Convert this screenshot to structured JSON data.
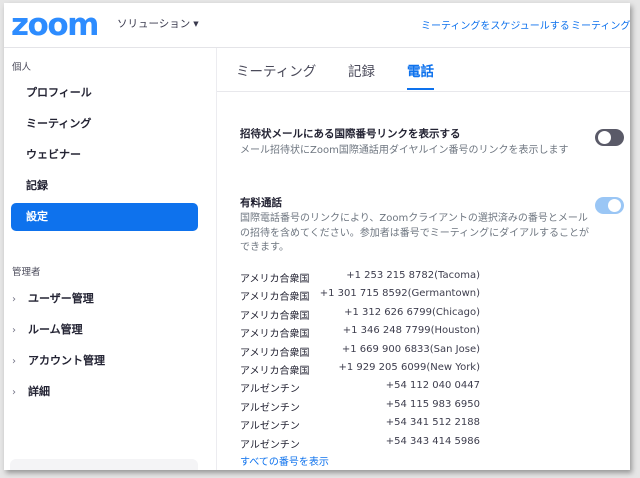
{
  "header": {
    "logo": "zoom",
    "solutions_label": "ソリューション",
    "links": [
      "ミーティングをスケジュールする",
      "ミーティングに参加する"
    ]
  },
  "sidebar": {
    "personal_label": "個人",
    "items": [
      "プロフィール",
      "ミーティング",
      "ウェビナー",
      "記録",
      "設定"
    ],
    "active_index": 4,
    "admin_label": "管理者",
    "admin_items": [
      "ユーザー管理",
      "ルーム管理",
      "アカウント管理",
      "詳細"
    ]
  },
  "tabs": {
    "items": [
      "ミーティング",
      "記録",
      "電話"
    ],
    "active_index": 2
  },
  "settings": [
    {
      "title": "招待状メールにある国際番号リンクを表示する",
      "description": "メール招待状にZoom国際通話用ダイヤルイン番号のリンクを表示します",
      "enabled": false
    },
    {
      "title": "有料通話",
      "description": "国際電話番号のリンクにより、Zoomクライアントの選択済みの番号とメールの招待を含めてください。参加者は番号でミーティングにダイアルすることができます。",
      "enabled": true
    }
  ],
  "numbers": [
    {
      "country": "アメリカ合衆国",
      "number": "+1 253 215 8782(Tacoma)"
    },
    {
      "country": "アメリカ合衆国",
      "number": "+1 301 715 8592(Germantown)"
    },
    {
      "country": "アメリカ合衆国",
      "number": "+1 312 626 6799(Chicago)"
    },
    {
      "country": "アメリカ合衆国",
      "number": "+1 346 248 7799(Houston)"
    },
    {
      "country": "アメリカ合衆国",
      "number": "+1 669 900 6833(San Jose)"
    },
    {
      "country": "アメリカ合衆国",
      "number": "+1 929 205 6099(New York)"
    },
    {
      "country": "アルゼンチン",
      "number": "+54 112 040 0447"
    },
    {
      "country": "アルゼンチン",
      "number": "+54 115 983 6950"
    },
    {
      "country": "アルゼンチン",
      "number": "+54 341 512 2188"
    },
    {
      "country": "アルゼンチン",
      "number": "+54 343 414 5986"
    }
  ],
  "show_all_label": "すべての番号を表示",
  "colors": {
    "accent": "#0e72ed",
    "brand": "#2d8cff"
  }
}
